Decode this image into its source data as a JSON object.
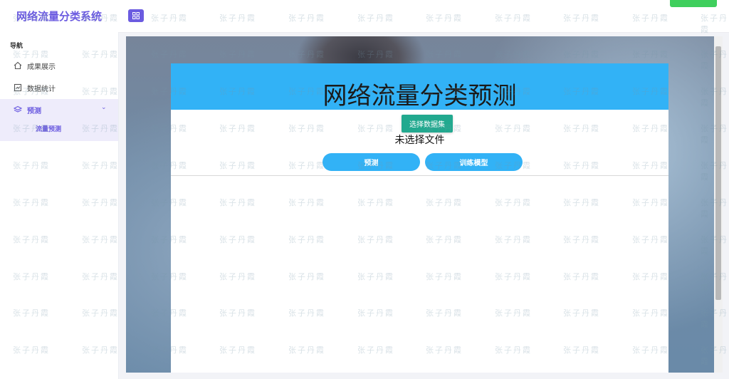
{
  "brand": "网络流量分类系统",
  "nav": {
    "title": "导航",
    "items": [
      {
        "label": "成果展示",
        "icon": "home-icon"
      },
      {
        "label": "数据统计",
        "icon": "chart-icon"
      },
      {
        "label": "预测",
        "icon": "layers-icon"
      }
    ],
    "sub_items": [
      {
        "label": "流量预测"
      }
    ]
  },
  "panel": {
    "title": "网络流量分类预测",
    "choose_button": "选择数据集",
    "file_status": "未选择文件",
    "predict_button": "预测",
    "train_button": "训练模型"
  },
  "watermark": "张子丹霞",
  "colors": {
    "accent": "#6b5be0",
    "primary_blue": "#32b2f6",
    "teal": "#22a98f",
    "green": "#3fcf5d"
  }
}
